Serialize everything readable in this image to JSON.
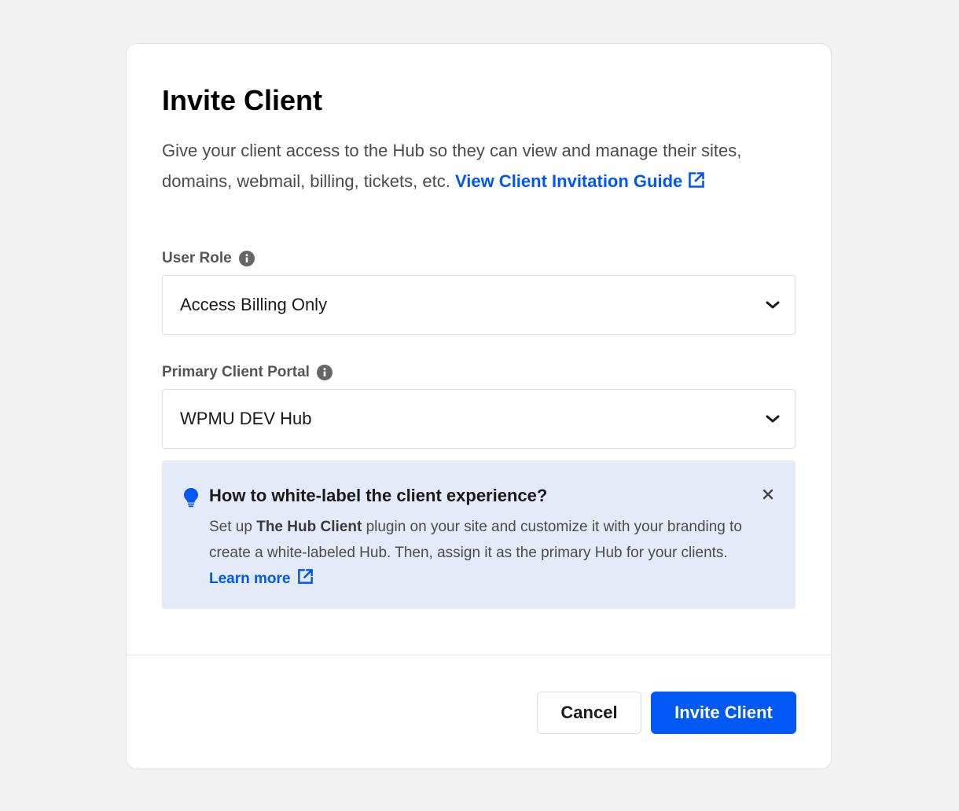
{
  "modal": {
    "title": "Invite Client",
    "description": "Give your client access to the Hub so they can view and manage their sites, domains, webmail, billing, tickets, etc.",
    "guide_link": "View Client Invitation Guide"
  },
  "user_role": {
    "label": "User Role",
    "value": "Access Billing Only"
  },
  "client_portal": {
    "label": "Primary Client Portal",
    "value": "WPMU DEV Hub"
  },
  "notice": {
    "title": "How to white-label the client experience?",
    "text_before": "Set up",
    "plugin_name": "The Hub Client",
    "text_after": "plugin on your site and customize it with your branding to create a white-labeled Hub. Then, assign it as the primary Hub for your clients.",
    "learn_more": "Learn more"
  },
  "footer": {
    "cancel_label": "Cancel",
    "invite_label": "Invite Client"
  },
  "colors": {
    "accent": "#0058f5",
    "notice_bg": "#e4eaf8",
    "page_bg": "#f2f2f2"
  },
  "icons": [
    "external-link-icon",
    "info-icon",
    "chevron-down-icon",
    "lightbulb-icon",
    "close-icon"
  ]
}
